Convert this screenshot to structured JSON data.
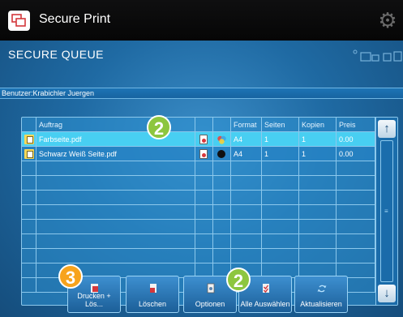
{
  "app": {
    "title": "Secure Print"
  },
  "queue": {
    "title": "SECURE QUEUE",
    "user_label": "Benutzer:Krabichler Juergen"
  },
  "table": {
    "columns": [
      "Auftrag",
      "",
      "",
      "Format",
      "Seiten",
      "Kopien",
      "Preis"
    ],
    "rows": [
      {
        "name": "Farbseite.pdf",
        "color_mode": "color",
        "format": "A4",
        "pages": "1",
        "copies": "1",
        "price": "0.00",
        "selected": true
      },
      {
        "name": "Schwarz Weiß Seite.pdf",
        "color_mode": "bw",
        "format": "A4",
        "pages": "1",
        "copies": "1",
        "price": "0.00",
        "selected": false
      }
    ]
  },
  "buttons": {
    "print_delete": "Drucken + Lös...",
    "delete": "Löschen",
    "options": "Optionen",
    "select_all": "Alle Auswählen",
    "refresh": "Aktualisieren"
  },
  "callouts": {
    "row_marker": "2",
    "select_all_marker": "2",
    "print_marker": "3"
  },
  "colors": {
    "selected_row": "#48cff2",
    "callout_green": "#8dc63f",
    "callout_orange": "#f7a31c",
    "accent": "#1f6aa3"
  }
}
